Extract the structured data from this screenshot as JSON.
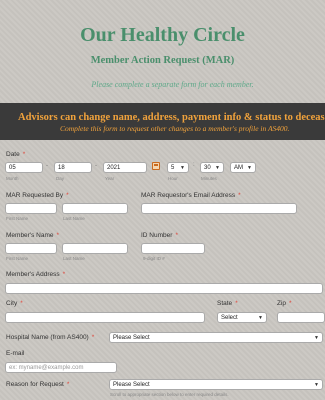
{
  "header": {
    "title": "Our Healthy Circle",
    "subtitle": "Member Action Request (MAR)",
    "note": "Please complete a separate form for each member."
  },
  "banner": {
    "line1": "Advisors can change name, address, payment info & status to deceased",
    "line2": "Complete this form to request other changes to a member's profile in AS400."
  },
  "date": {
    "label": "Date",
    "month": "05",
    "day": "18",
    "year": "2021",
    "hour": "5",
    "minutes": "30",
    "ampm": "AM",
    "sublabels": {
      "month": "Month",
      "day": "Day",
      "year": "Year",
      "hour": "Hour",
      "minutes": "Minutes"
    }
  },
  "mar_requested_by": {
    "label": "MAR Requested By",
    "first": "",
    "last": "",
    "sub_first": "First Name",
    "sub_last": "Last Name"
  },
  "requestor_email": {
    "label": "MAR Requestor's Email Address",
    "value": ""
  },
  "member_name": {
    "label": "Member's Name",
    "first": "",
    "last": "",
    "sub_first": "First Name",
    "sub_last": "Last Name"
  },
  "id_number": {
    "label": "ID Number",
    "value": "",
    "sub": "9-digit ID #"
  },
  "member_address": {
    "label": "Member's Address",
    "value": ""
  },
  "city": {
    "label": "City",
    "value": ""
  },
  "state": {
    "label": "State",
    "selected": "Select"
  },
  "zip": {
    "label": "Zip",
    "value": ""
  },
  "hospital": {
    "label": "Hospital Name (from AS400)",
    "selected": "Please Select"
  },
  "email": {
    "label": "E-mail",
    "placeholder": "ex: myname@example.com"
  },
  "reason": {
    "label": "Reason for Request",
    "selected": "Please Select",
    "help": "Scroll to appropriate section below to enter required details."
  },
  "required_mark": "*",
  "colors": {
    "accent_green": "#4a8f6c",
    "banner_bg": "#3a3a3a",
    "banner_text": "#f0a23c",
    "required": "#e0453a"
  },
  "icons": {
    "calendar": "calendar-icon",
    "dropdown": "chevron-down-icon"
  }
}
